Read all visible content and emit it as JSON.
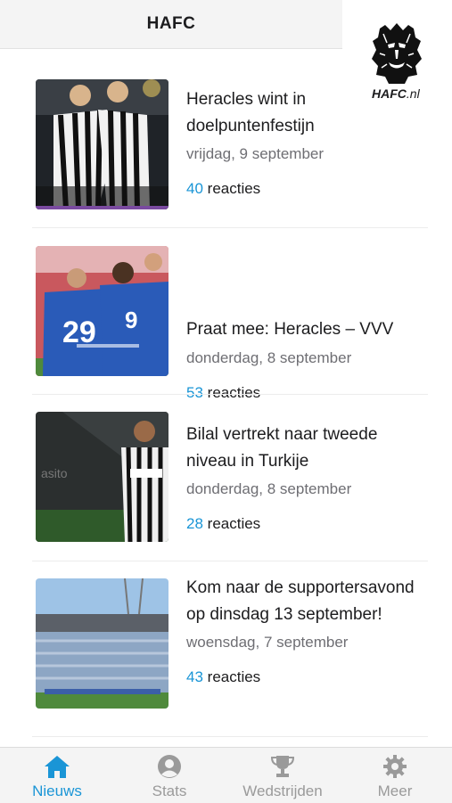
{
  "header": {
    "title": "HAFC"
  },
  "logo": {
    "text_main": "HAFC",
    "text_suffix": ".nl"
  },
  "articles": [
    {
      "title": "Heracles wint in doelpuntenfestijn",
      "date": "vrijdag, 9 september",
      "comments": "40",
      "comments_label": "reacties"
    },
    {
      "title": "Praat mee: Heracles – VVV",
      "date": "donderdag, 8 september",
      "comments": "53",
      "comments_label": "reacties"
    },
    {
      "title": "Bilal vertrekt naar tweede niveau in Turkije",
      "date": "donderdag, 8 september",
      "comments": "28",
      "comments_label": "reacties"
    },
    {
      "title": "Kom naar de supportersavond op dinsdag 13 september!",
      "date": "woensdag, 7 september",
      "comments": "43",
      "comments_label": "reacties"
    }
  ],
  "tabs": [
    {
      "label": "Nieuws",
      "icon": "home-icon",
      "active": true
    },
    {
      "label": "Stats",
      "icon": "person-icon",
      "active": false
    },
    {
      "label": "Wedstrijden",
      "icon": "trophy-icon",
      "active": false
    },
    {
      "label": "Meer",
      "icon": "gear-icon",
      "active": false
    }
  ],
  "colors": {
    "accent": "#1a95d6",
    "header_bg": "#f4f4f4",
    "muted_text": "#6e6e73"
  }
}
